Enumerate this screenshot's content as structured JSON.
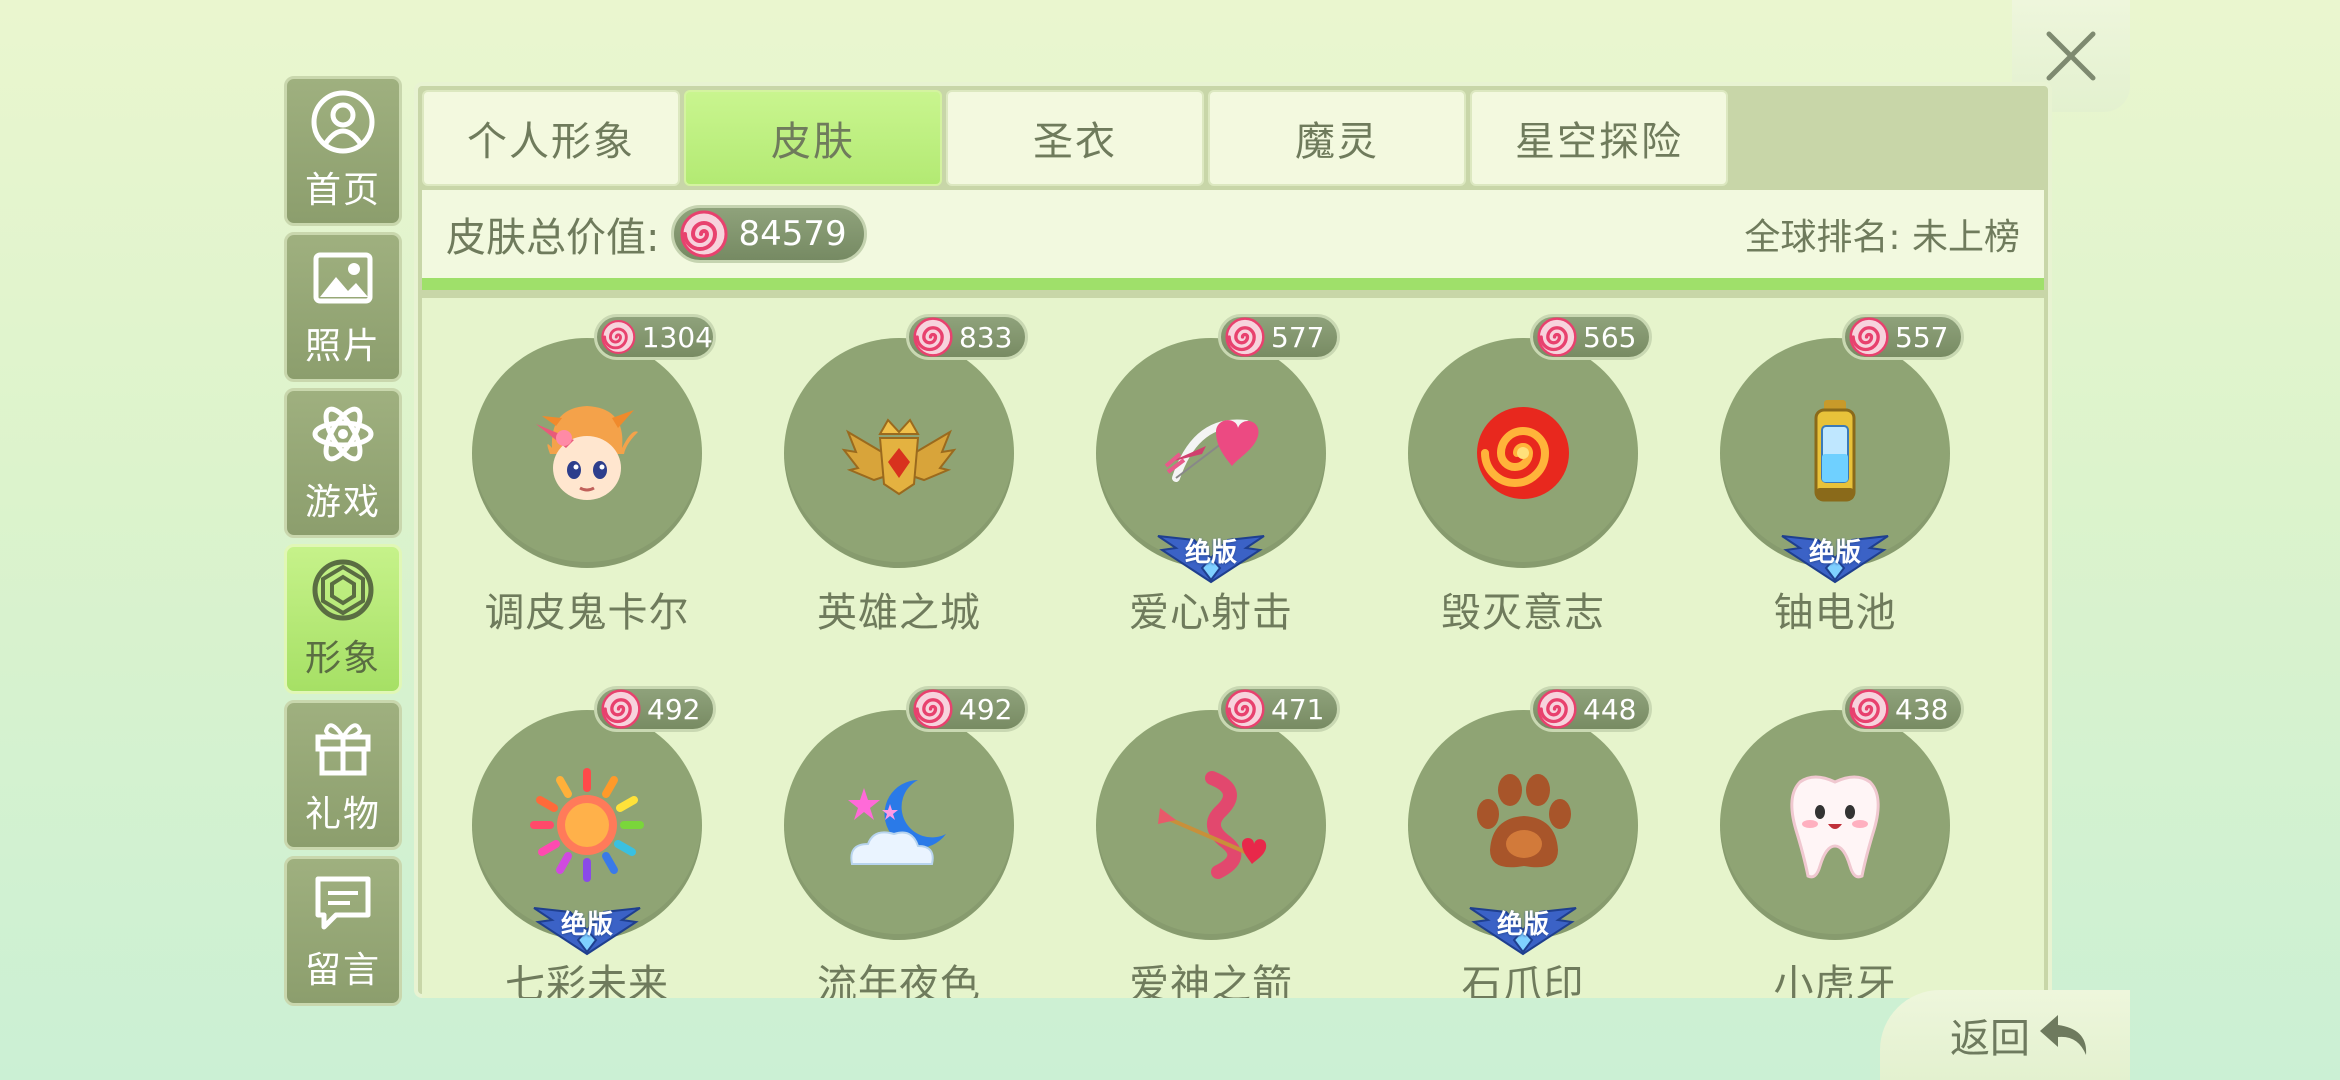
{
  "sidebar": {
    "items": [
      {
        "label": "首页",
        "icon": "user-circle-icon",
        "active": false
      },
      {
        "label": "照片",
        "icon": "image-icon",
        "active": false
      },
      {
        "label": "游戏",
        "icon": "atom-icon",
        "active": false
      },
      {
        "label": "形象",
        "icon": "gem-icon",
        "active": true
      },
      {
        "label": "礼物",
        "icon": "gift-icon",
        "active": false
      },
      {
        "label": "留言",
        "icon": "message-icon",
        "active": false
      }
    ]
  },
  "tabs": [
    {
      "label": "个人形象",
      "active": false
    },
    {
      "label": "皮肤",
      "active": true
    },
    {
      "label": "圣衣",
      "active": false
    },
    {
      "label": "魔灵",
      "active": false
    },
    {
      "label": "星空探险",
      "active": false
    }
  ],
  "summary": {
    "total_label": "皮肤总价值:",
    "total_value": "84579",
    "rank_text": "全球排名: 未上榜"
  },
  "limited_label": "绝版",
  "items": [
    {
      "name": "调皮鬼卡尔",
      "price": "1304",
      "limited": false,
      "icon": "karl-avatar-icon"
    },
    {
      "name": "英雄之城",
      "price": "833",
      "limited": false,
      "icon": "winged-crown-icon"
    },
    {
      "name": "爱心射击",
      "price": "577",
      "limited": true,
      "icon": "heart-bow-icon"
    },
    {
      "name": "毁灭意志",
      "price": "565",
      "limited": false,
      "icon": "flame-swirl-icon"
    },
    {
      "name": "铀电池",
      "price": "557",
      "limited": true,
      "icon": "battery-icon"
    },
    {
      "name": "七彩未来",
      "price": "492",
      "limited": true,
      "icon": "rainbow-sun-icon"
    },
    {
      "name": "流年夜色",
      "price": "492",
      "limited": false,
      "icon": "moon-cloud-icon"
    },
    {
      "name": "爱神之箭",
      "price": "471",
      "limited": false,
      "icon": "cupid-arrow-icon"
    },
    {
      "name": "石爪印",
      "price": "448",
      "limited": true,
      "icon": "paw-print-icon"
    },
    {
      "name": "小虎牙",
      "price": "438",
      "limited": false,
      "icon": "tooth-icon"
    }
  ],
  "back": {
    "label": "返回"
  },
  "colors": {
    "accent_green": "#a6e065",
    "circle": "#8fa474",
    "candy_pink": "#e8416e"
  }
}
